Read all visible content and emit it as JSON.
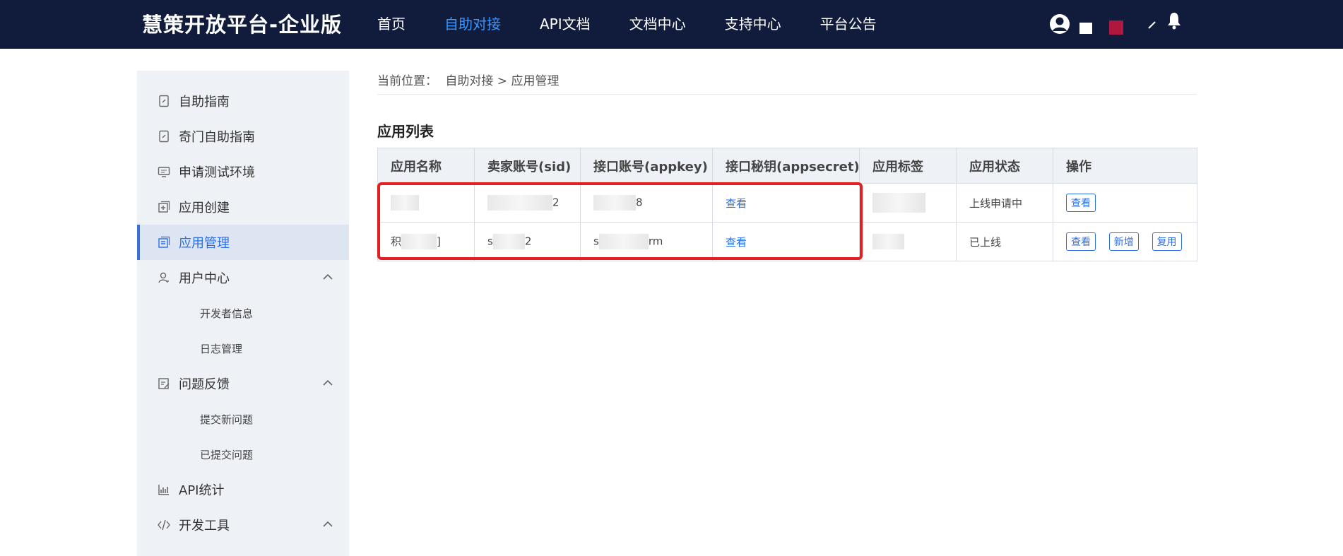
{
  "header": {
    "brand": "慧策开放平台-企业版",
    "nav": [
      {
        "label": "首页",
        "active": false
      },
      {
        "label": "自助对接",
        "active": true
      },
      {
        "label": "API文档",
        "active": false
      },
      {
        "label": "文档中心",
        "active": false
      },
      {
        "label": "支持中心",
        "active": false
      },
      {
        "label": "平台公告",
        "active": false
      }
    ],
    "icons": [
      "user-avatar-icon",
      "edit-icon",
      "bell-icon"
    ]
  },
  "sidebar": {
    "items": [
      {
        "label": "自助指南",
        "icon": "guide-doc-icon"
      },
      {
        "label": "奇门自助指南",
        "icon": "guide-doc-icon"
      },
      {
        "label": "申请测试环境",
        "icon": "monitor-icon"
      },
      {
        "label": "应用创建",
        "icon": "add-box-icon"
      },
      {
        "label": "应用管理",
        "icon": "app-manage-icon",
        "active": true
      },
      {
        "label": "用户中心",
        "icon": "user-icon",
        "expanded": true,
        "children": [
          "开发者信息",
          "日志管理"
        ]
      },
      {
        "label": "问题反馈",
        "icon": "feedback-icon",
        "expanded": true,
        "children": [
          "提交新问题",
          "已提交问题"
        ]
      },
      {
        "label": "API统计",
        "icon": "bar-chart-icon"
      },
      {
        "label": "开发工具",
        "icon": "code-icon",
        "expanded": true
      }
    ]
  },
  "breadcrumb": {
    "prefix": "当前位置：",
    "path": "自助对接 > 应用管理"
  },
  "section": {
    "title": "应用列表"
  },
  "table": {
    "columns": [
      "应用名称",
      "卖家账号(sid)",
      "接口账号(appkey)",
      "接口秘钥(appsecret)",
      "应用标签",
      "应用状态",
      "操作"
    ],
    "rows": [
      {
        "name_visible": "",
        "sid_visible": "2",
        "appkey_prefix": "",
        "appkey_suffix": "8",
        "secret_link": "查看",
        "status": "上线申请中",
        "actions": [
          "查看"
        ]
      },
      {
        "name_prefix": "积",
        "name_suffix": "]",
        "sid_prefix": "s",
        "sid_suffix": "2",
        "appkey_prefix": "s",
        "appkey_suffix": "rm",
        "secret_link": "查看",
        "status": "已上线",
        "actions": [
          "查看",
          "新增",
          "复用"
        ]
      }
    ]
  }
}
